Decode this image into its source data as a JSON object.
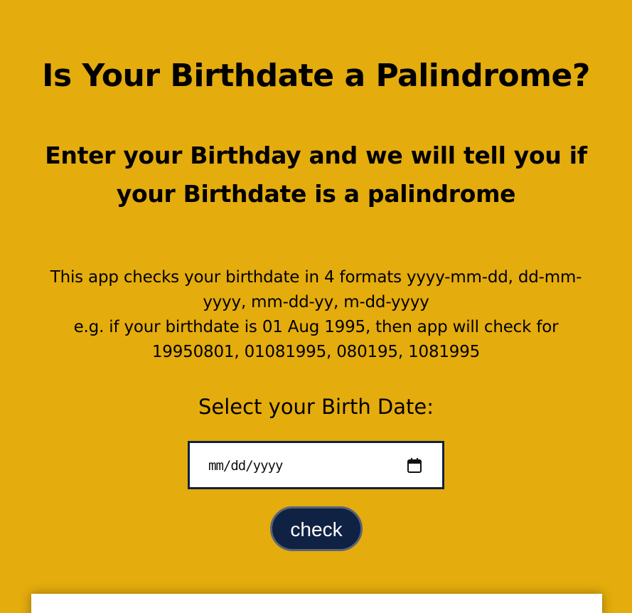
{
  "header": {
    "title": "Is Your Birthdate a Palindrome?",
    "subtitle": "Enter your Birthday and we will tell you if your Birthdate is a palindrome"
  },
  "info": {
    "line1": "This app checks your birthdate in 4 formats yyyy-mm-dd, dd-mm-yyyy, mm-dd-yy, m-dd-yyyy",
    "line2": "e.g. if your birthdate is 01 Aug 1995, then app will check for 19950801, 01081995, 080195, 1081995"
  },
  "form": {
    "label": "Select your Birth Date:",
    "date_placeholder": "mm/dd/yyyy",
    "date_value": "",
    "calendar_icon": "calendar-icon",
    "check_label": "check"
  },
  "output": {
    "text": ""
  },
  "colors": {
    "background": "#e4ac0d",
    "button": "#0f2244",
    "input_border": "#0f2240"
  }
}
